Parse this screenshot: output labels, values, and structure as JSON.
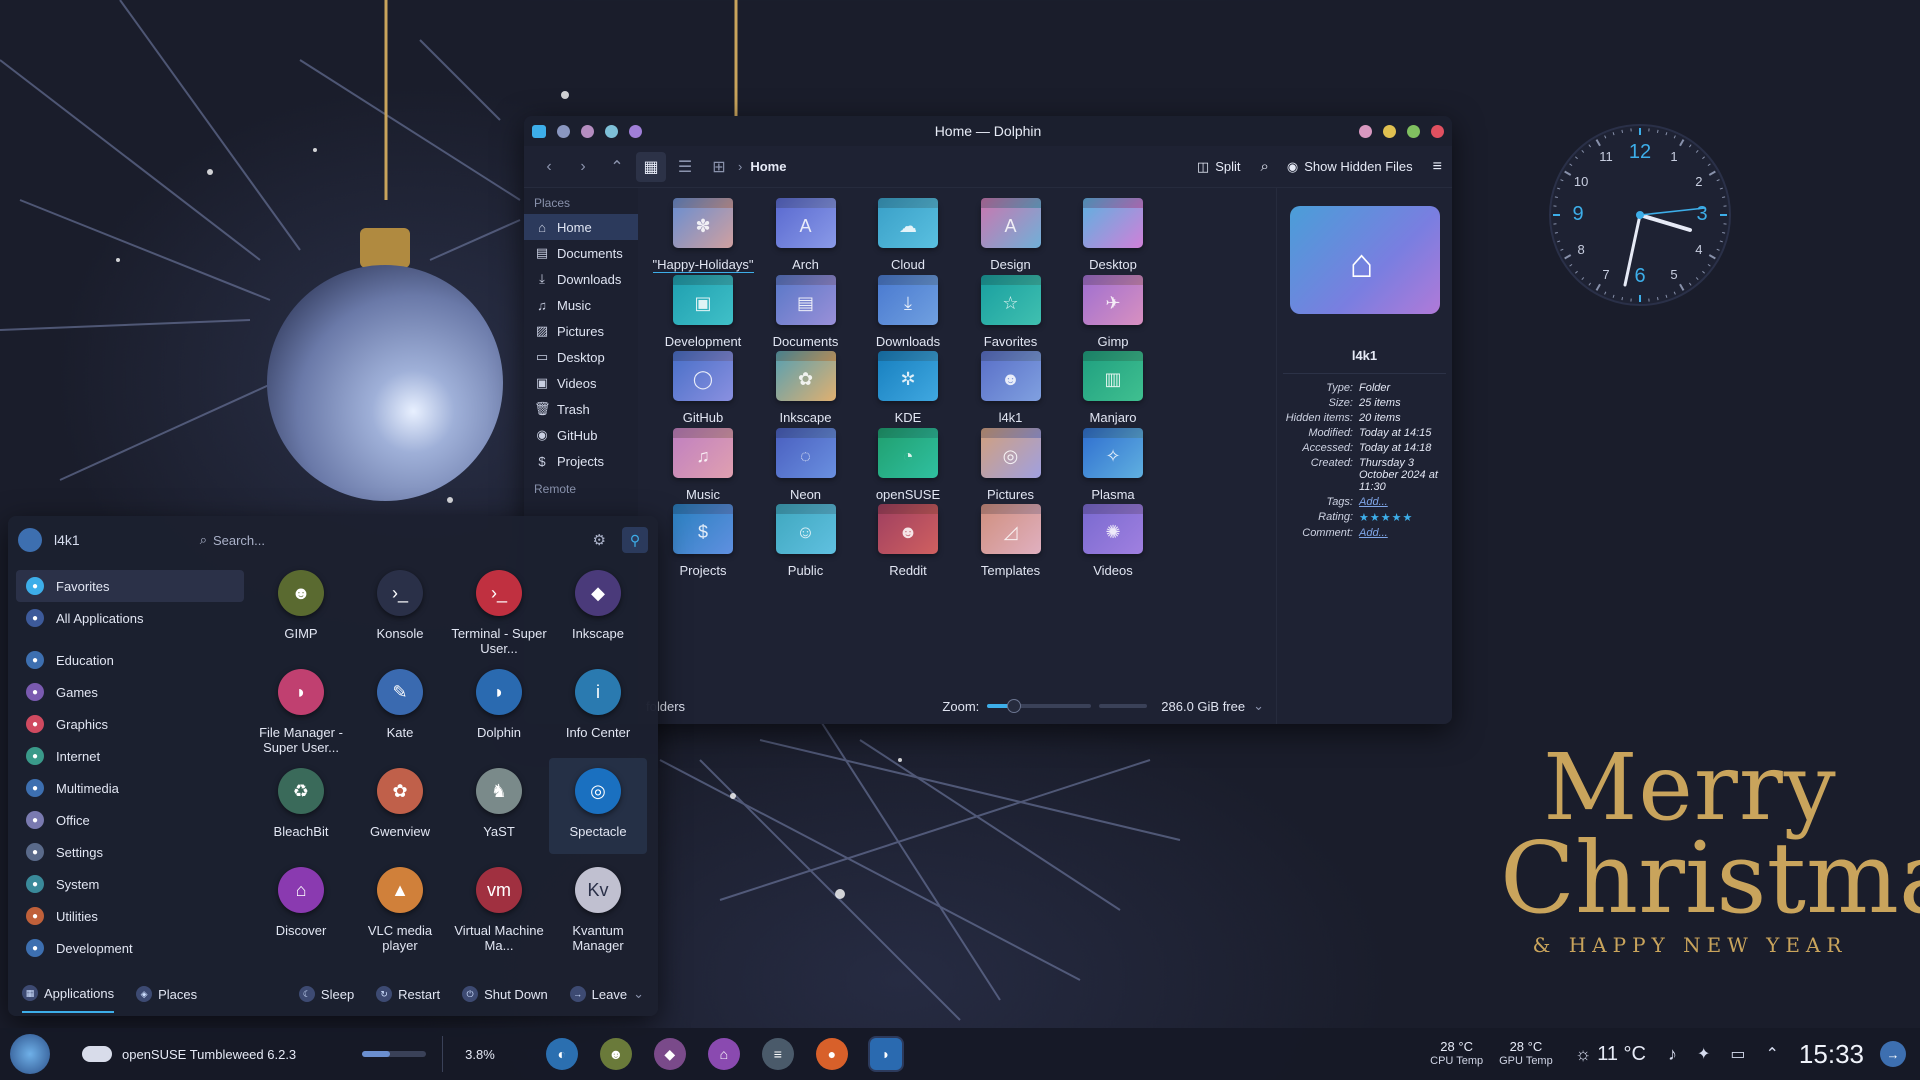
{
  "window": {
    "title": "Home — Dolphin"
  },
  "toolbar": {
    "breadcrumb": "Home",
    "split": "Split",
    "show_hidden": "Show Hidden Files"
  },
  "places": {
    "header": "Places",
    "remote_header": "Remote",
    "items": [
      {
        "label": "Home",
        "icon": "home-icon"
      },
      {
        "label": "Documents",
        "icon": "document-icon"
      },
      {
        "label": "Downloads",
        "icon": "download-icon"
      },
      {
        "label": "Music",
        "icon": "music-icon"
      },
      {
        "label": "Pictures",
        "icon": "picture-icon"
      },
      {
        "label": "Desktop",
        "icon": "desktop-icon"
      },
      {
        "label": "Videos",
        "icon": "video-icon"
      },
      {
        "label": "Trash",
        "icon": "trash-icon"
      },
      {
        "label": "GitHub",
        "icon": "github-icon"
      },
      {
        "label": "Projects",
        "icon": "dollar-icon"
      }
    ]
  },
  "folders": [
    {
      "label": "\"Happy-Holidays\""
    },
    {
      "label": "Arch"
    },
    {
      "label": "Cloud"
    },
    {
      "label": "Design"
    },
    {
      "label": "Desktop"
    },
    {
      "label": "Development"
    },
    {
      "label": "Documents"
    },
    {
      "label": "Downloads"
    },
    {
      "label": "Favorites"
    },
    {
      "label": "Gimp"
    },
    {
      "label": "GitHub"
    },
    {
      "label": "Inkscape"
    },
    {
      "label": "KDE"
    },
    {
      "label": "l4k1"
    },
    {
      "label": "Manjaro"
    },
    {
      "label": "Music"
    },
    {
      "label": "Neon"
    },
    {
      "label": "openSUSE"
    },
    {
      "label": "Pictures"
    },
    {
      "label": "Plasma"
    },
    {
      "label": "Projects"
    },
    {
      "label": "Public"
    },
    {
      "label": "Reddit"
    },
    {
      "label": "Templates"
    },
    {
      "label": "Videos"
    }
  ],
  "status": {
    "folders": "folders",
    "zoom_label": "Zoom:",
    "free": "286.0 GiB free"
  },
  "info": {
    "name": "l4k1",
    "type_k": "Type:",
    "type_v": "Folder",
    "size_k": "Size:",
    "size_v": "25 items",
    "hidden_k": "Hidden items:",
    "hidden_v": "20 items",
    "modified_k": "Modified:",
    "modified_v": "Today at 14:15",
    "accessed_k": "Accessed:",
    "accessed_v": "Today at 14:18",
    "created_k": "Created:",
    "created_v": "Thursday 3 October 2024 at 11:30",
    "tags_k": "Tags:",
    "tags_v": "Add...",
    "rating_k": "Rating:",
    "rating_v": "★★★★★",
    "comment_k": "Comment:",
    "comment_v": "Add..."
  },
  "launcher": {
    "user": "l4k1",
    "search_placeholder": "Search...",
    "categories": [
      {
        "label": "Favorites"
      },
      {
        "label": "All Applications"
      },
      {
        "label": "Education"
      },
      {
        "label": "Games"
      },
      {
        "label": "Graphics"
      },
      {
        "label": "Internet"
      },
      {
        "label": "Multimedia"
      },
      {
        "label": "Office"
      },
      {
        "label": "Settings"
      },
      {
        "label": "System"
      },
      {
        "label": "Utilities"
      },
      {
        "label": "Development"
      }
    ],
    "apps": [
      {
        "label": "GIMP"
      },
      {
        "label": "Konsole"
      },
      {
        "label": "Terminal - Super User..."
      },
      {
        "label": "Inkscape"
      },
      {
        "label": "File Manager - Super User..."
      },
      {
        "label": "Kate"
      },
      {
        "label": "Dolphin"
      },
      {
        "label": "Info Center"
      },
      {
        "label": "BleachBit"
      },
      {
        "label": "Gwenview"
      },
      {
        "label": "YaST"
      },
      {
        "label": "Spectacle"
      },
      {
        "label": "Discover"
      },
      {
        "label": "VLC media player"
      },
      {
        "label": "Virtual Machine Ma..."
      },
      {
        "label": "Kvantum Manager"
      }
    ],
    "footer": {
      "applications": "Applications",
      "places": "Places",
      "sleep": "Sleep",
      "restart": "Restart",
      "shutdown": "Shut Down",
      "leave": "Leave"
    }
  },
  "taskbar": {
    "os": "openSUSE Tumbleweed 6.2.3",
    "cpu_pct": "3.8%",
    "cpu_temp": "28 °C",
    "cpu_temp_label": "CPU Temp",
    "gpu_temp": "28 °C",
    "gpu_temp_label": "GPU Temp",
    "weather": "11 °C",
    "time": "15:33"
  },
  "wallpaper": {
    "line1": "Merry",
    "line2": "Christmas",
    "line3": "& HAPPY NEW YEAR"
  },
  "clock_numbers": [
    "12",
    "1",
    "2",
    "3",
    "4",
    "5",
    "6",
    "7",
    "8",
    "9",
    "10",
    "11"
  ],
  "colors": {
    "accent": "#3daee9",
    "gold": "#c9a45c",
    "bg": "#1a1d2b"
  }
}
